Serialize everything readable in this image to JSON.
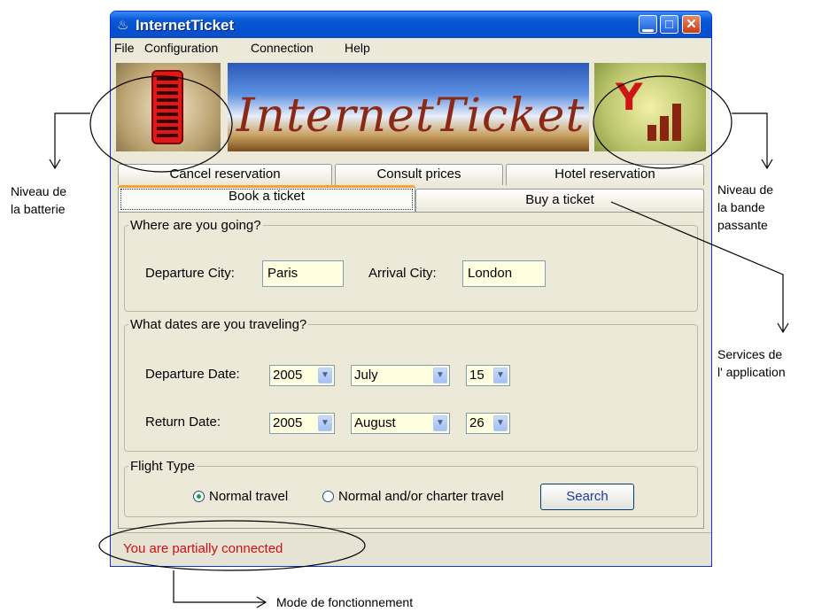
{
  "window": {
    "title": "InternetTicket",
    "menu": [
      "File",
      "Configuration",
      "Connection",
      "Help"
    ],
    "banner_logo": "InternetTicket"
  },
  "tabs": {
    "row_back": [
      "Cancel reservation",
      "Consult prices",
      "Hotel reservation"
    ],
    "row_front": [
      "Book a ticket",
      "Buy a ticket"
    ],
    "active": "Book a ticket"
  },
  "where": {
    "legend": "Where are you going?",
    "departure_label": "Departure City:",
    "departure_value": "Paris",
    "arrival_label": "Arrival City:",
    "arrival_value": "London"
  },
  "dates": {
    "legend": "What dates are you traveling?",
    "departure_label": "Departure Date:",
    "departure": {
      "year": "2005",
      "month": "July",
      "day": "15"
    },
    "return_label": "Return Date:",
    "return": {
      "year": "2005",
      "month": "August",
      "day": "26"
    }
  },
  "flight": {
    "legend": "Flight Type",
    "option_normal": "Normal travel",
    "option_charter": "Normal and/or charter travel",
    "selected": "Normal travel",
    "search_label": "Search"
  },
  "status": {
    "text": "You are partially connected",
    "color": "#d01010"
  },
  "annotations": {
    "battery_1": "Niveau de",
    "battery_2": "la batterie",
    "bandwidth_1": "Niveau de",
    "bandwidth_2": "la bande",
    "bandwidth_3": "passante",
    "services_1": "Services de",
    "services_2": "l'  application",
    "mode": "Mode de fonctionnement"
  },
  "icons": {
    "battery": "battery-level-icon",
    "signal": "bandwidth-signal-icon",
    "app": "java-cup-icon"
  }
}
